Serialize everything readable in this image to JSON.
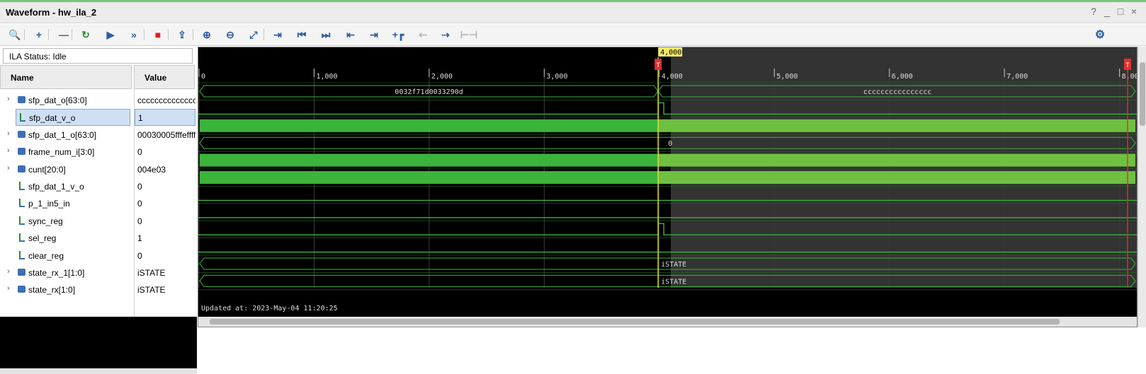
{
  "window": {
    "title": "Waveform - hw_ila_2",
    "help": "?",
    "minimize": "_",
    "maximize": "□",
    "close": "×"
  },
  "toolbar": {
    "icons": [
      {
        "name": "search-icon",
        "glyph": "🔍"
      },
      {
        "name": "add-icon",
        "glyph": "+"
      },
      {
        "name": "remove-icon",
        "glyph": "—"
      },
      {
        "name": "run-trigger-immediate-icon",
        "glyph": "↻"
      },
      {
        "name": "run-trigger-icon",
        "glyph": "▶"
      },
      {
        "name": "run-immediate-icon",
        "glyph": "»"
      },
      {
        "name": "stop-icon",
        "glyph": "■"
      },
      {
        "name": "export-icon",
        "glyph": "⇪"
      },
      {
        "name": "zoom-in-icon",
        "glyph": "⊕"
      },
      {
        "name": "zoom-out-icon",
        "glyph": "⊖"
      },
      {
        "name": "zoom-fit-icon",
        "glyph": "⤢"
      },
      {
        "name": "go-to-cursor-icon",
        "glyph": "⇥"
      },
      {
        "name": "go-to-start-icon",
        "glyph": "⏮"
      },
      {
        "name": "go-to-end-icon",
        "glyph": "⏭"
      },
      {
        "name": "previous-transition-icon",
        "glyph": "⇤"
      },
      {
        "name": "next-transition-icon",
        "glyph": "⇥"
      },
      {
        "name": "add-marker-icon",
        "glyph": "+┏"
      },
      {
        "name": "previous-marker-icon",
        "glyph": "⇠"
      },
      {
        "name": "next-marker-icon",
        "glyph": "⇢"
      },
      {
        "name": "swap-cursors-icon",
        "glyph": "⊢⊣"
      }
    ],
    "settings_glyph": "⚙"
  },
  "status": {
    "text": "ILA Status:  Idle"
  },
  "columns": {
    "name": "Name",
    "value": "Value"
  },
  "signals": [
    {
      "name": "sfp_dat_o[63:0]",
      "value": "cccccccccccccccc",
      "bus": true,
      "selected": false
    },
    {
      "name": "sfp_dat_v_o",
      "value": "1",
      "bus": false,
      "selected": true
    },
    {
      "name": "sfp_dat_1_o[63:0]",
      "value": "00030005fffeffff",
      "bus": true,
      "selected": false
    },
    {
      "name": "frame_num_i[3:0]",
      "value": "0",
      "bus": true,
      "selected": false
    },
    {
      "name": "cunt[20:0]",
      "value": "004e03",
      "bus": true,
      "selected": false
    },
    {
      "name": "sfp_dat_1_v_o",
      "value": "0",
      "bus": false,
      "selected": false
    },
    {
      "name": "p_1_in5_in",
      "value": "0",
      "bus": false,
      "selected": false
    },
    {
      "name": "sync_reg",
      "value": "0",
      "bus": false,
      "selected": false
    },
    {
      "name": "sel_reg",
      "value": "1",
      "bus": false,
      "selected": false
    },
    {
      "name": "clear_reg",
      "value": "0",
      "bus": false,
      "selected": false
    },
    {
      "name": "state_rx_1[1:0]",
      "value": "iSTATE",
      "bus": true,
      "selected": false
    },
    {
      "name": "state_rx[1:0]",
      "value": "iSTATE",
      "bus": true,
      "selected": false
    }
  ],
  "timeline": {
    "range": [
      0,
      8150
    ],
    "ticks": [
      "0",
      "1,000",
      "2,000",
      "3,000",
      "4,000",
      "5,000",
      "6,000",
      "7,000",
      "8,000"
    ],
    "tick_values": [
      0,
      1000,
      2000,
      3000,
      4000,
      5000,
      6000,
      7000,
      8000
    ],
    "cursor_value": 3990,
    "cursor_label": "4,000",
    "trigger_value": 3990,
    "trigger_marker": "T",
    "end_trigger_value": 8070,
    "end_trigger_marker": "T",
    "post_trigger_start": 4100
  },
  "waves": {
    "sfp_dat_o_before": "0032f71d0033290d",
    "sfp_dat_o_after": "cccccccccccccccc",
    "frame_num_value": "0",
    "state_rx_1_value": "iSTATE",
    "state_rx_value": "iSTATE"
  },
  "footer": {
    "updated": "Updated at: 2023-May-04 11:20:25"
  },
  "colors": {
    "wave_green": "#3ab43a",
    "wave_green_post": "#6fc040",
    "cursor": "#e4e43c",
    "trigger_red": "#e03030",
    "post_shade": "#333333",
    "grid": "#3a3a3a"
  }
}
